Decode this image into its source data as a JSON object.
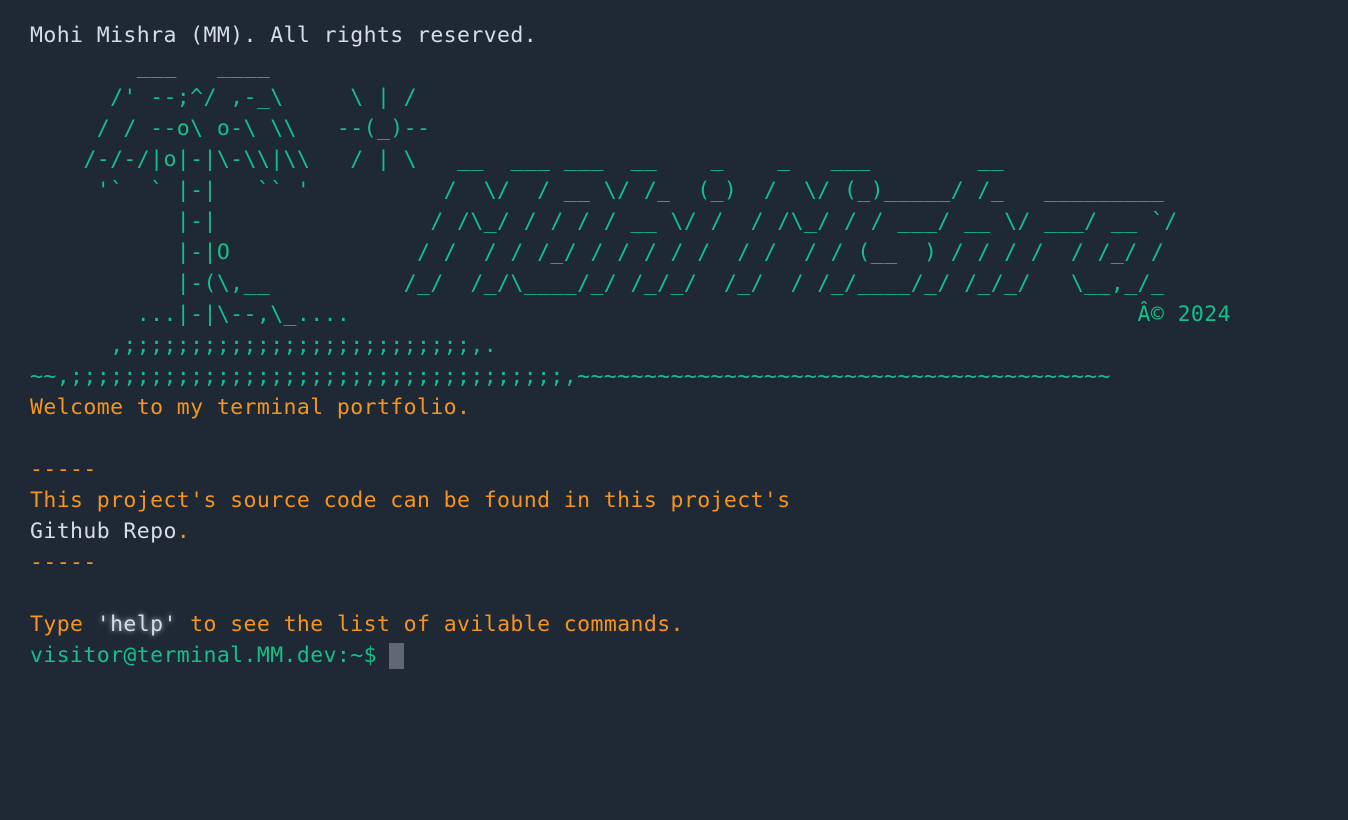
{
  "header": {
    "copyright": "Mohi Mishra (MM). All rights reserved."
  },
  "ascii_art": {
    "banner": "        ___   ____\n      /' --;^/ ,-_\\     \\ | /\n     / / --o\\ o-\\ \\\\   --(_)--\n    /-/-/|o|-|\\-\\\\|\\\\   / | \\   __  ___ ___  __    _    _   ___        __\n     '`  ` |-|   `` '          /  \\/  / __ \\/ /_  (_)  /  \\/ (_)_____/ /_   _________\n           |-|                / /\\_/ / / / / __ \\/ /  / /\\_/ / / ___/ __ \\/ ___/ __ `/\n           |-|O              / /  / / /_/ / / / / /  / /  / / (__  ) / / / /  / /_/ /\n           |-(\\,__          /_/  /_/\\____/_/ /_/_/  /_/  / /_/____/_/ /_/_/   \\__,_/_\n        ...|-|\\--,\\_....                                                           Â© 2024\n      ,;;;;;;;;;;;;;;;;;;;;;;;;;;,.\n~~,;;;;;;;;;;;;;;;;;;;;;;;;;;;;;;;;;;;;;,~~~~~~~~~~~~~~~~~~~~~~~~~~~~~~~~~~~~~~~~"
  },
  "welcome": "Welcome to my terminal portfolio.",
  "separator": "-----",
  "source_info": {
    "text": "This project's source code can be found in this project's",
    "link_label": "Github Repo",
    "period": "."
  },
  "help_hint": {
    "before": "Type ",
    "command": "'help'",
    "after": " to see the list of avilable commands."
  },
  "prompt": {
    "text": "visitor@terminal.MM.dev:~$",
    "input_value": ""
  },
  "colors": {
    "background": "#1e2935",
    "green": "#13c08a",
    "orange": "#f7941d",
    "text": "#d6dde6",
    "cursor": "#5f6874"
  }
}
